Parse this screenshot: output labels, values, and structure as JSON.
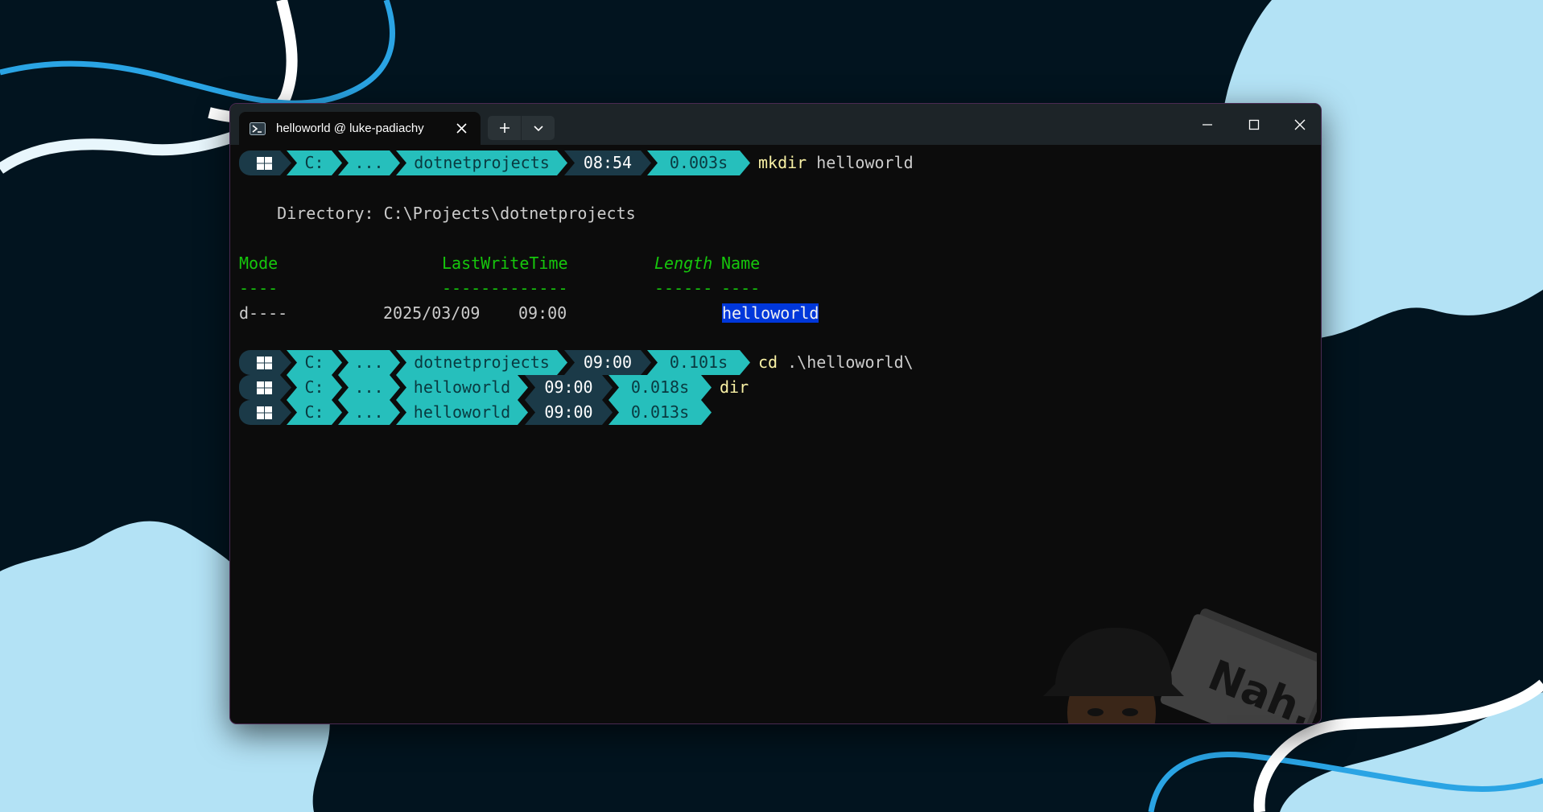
{
  "window": {
    "tab_title": "helloworld @ luke-padiachy",
    "tab_icon": "powershell-icon",
    "controls": [
      "minimize-icon",
      "maximize-icon",
      "close-icon"
    ]
  },
  "terminal": {
    "prompt1": {
      "drive": "C:",
      "ellipsis": "...",
      "folder": "dotnetprojects",
      "time": "08:54",
      "duration": "0.003s",
      "command": "mkdir",
      "args": "helloworld"
    },
    "directory_line": "    Directory: C:\\Projects\\dotnetprojects",
    "listing": {
      "headers": {
        "mode": "Mode",
        "lastwritetime": "LastWriteTime",
        "length": "Length",
        "name": "Name"
      },
      "rules": {
        "mode": "----",
        "lastwritetime": "-------------",
        "length": "------",
        "name": "----"
      },
      "rows": [
        {
          "mode": "d----",
          "date": "2025/03/09",
          "time": "09:00",
          "name": "helloworld"
        }
      ]
    },
    "prompt2": {
      "drive": "C:",
      "ellipsis": "...",
      "folder": "dotnetprojects",
      "time": "09:00",
      "duration": "0.101s",
      "command": "cd",
      "args": ".\\helloworld\\"
    },
    "prompt3": {
      "drive": "C:",
      "ellipsis": "...",
      "folder": "helloworld",
      "time": "09:00",
      "duration": "0.018s",
      "command": "dir",
      "args": ""
    },
    "prompt4": {
      "drive": "C:",
      "ellipsis": "...",
      "folder": "helloworld",
      "time": "09:00",
      "duration": "0.013s"
    }
  },
  "background_image": {
    "sign_text": "Nah."
  },
  "colors": {
    "terminal_bg": "#0c0c0c",
    "prompt_accent": "#26bfbc",
    "prompt_dark": "#1b3a48",
    "header_green": "#16c60c",
    "command_yellow": "#f9f1a5",
    "selection_blue": "#0037da"
  }
}
